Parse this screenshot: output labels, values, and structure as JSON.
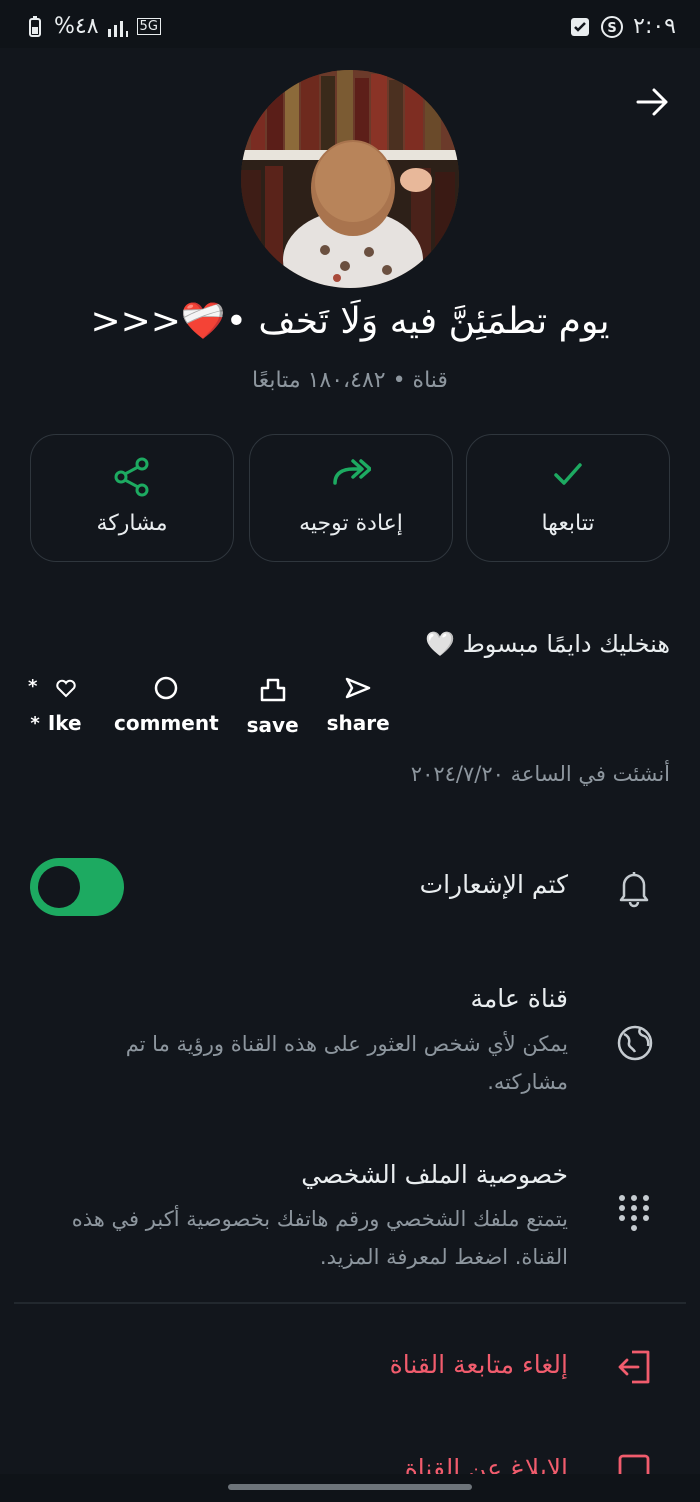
{
  "status_bar": {
    "battery": "%٤٨",
    "network": "5G",
    "time": "٢:٠٩"
  },
  "channel": {
    "name": "يوم تطمَئِنَّ فيه وَلَا تَخف •❤️‍🩹<<<",
    "subtitle": "قناة • ١٨٠،٤٨٢ متابعًا"
  },
  "actions": {
    "following": "تتابعها",
    "forward": "إعادة توجيه",
    "share": "مشاركة"
  },
  "description": {
    "text": "هنخليك دايمًا مبسوط 🤍",
    "like": "Ike",
    "comment": "comment",
    "save": "save",
    "share": "share",
    "created": "أنشئت في الساعة ٢٠٢٤/٧/٢٠"
  },
  "mute": {
    "label": "كتم الإشعارات",
    "enabled": true
  },
  "public_channel": {
    "title": "قناة عامة",
    "subtitle": "يمكن لأي شخص العثور على هذه القناة ورؤية ما تم مشاركته."
  },
  "profile_privacy": {
    "title": "خصوصية الملف الشخصي",
    "subtitle": "يتمتع ملفك الشخصي ورقم هاتفك بخصوصية أكبر في هذه القناة. اضغط لمعرفة المزيد."
  },
  "unfollow": "إلغاء متابعة القناة",
  "report": "الإبلاغ عن القناة",
  "colors": {
    "accent": "#1daa61",
    "danger": "#f15c6d",
    "background": "#12161c"
  }
}
